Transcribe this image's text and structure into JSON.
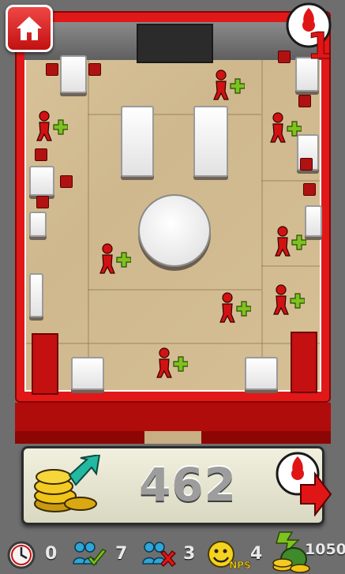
{
  "bank": {
    "amount": "462"
  },
  "level": {
    "value": "1"
  },
  "stats": {
    "wait_time": "0",
    "served": "7",
    "lost": "3",
    "nps": "4",
    "money": "1050",
    "nps_label": "NPS"
  },
  "colors": {
    "frame_red": "#e01818",
    "marker_green": "#7dc21f",
    "customer_red": "#d21212"
  },
  "icons": {
    "home": "home-icon",
    "bank_coins": "coins-up-icon",
    "next": "next-arrow-icon",
    "clock": "clock-icon",
    "served": "customers-check-icon",
    "lost": "customers-cross-icon",
    "nps": "smiley-nps-icon",
    "money": "money-bag-icon"
  }
}
